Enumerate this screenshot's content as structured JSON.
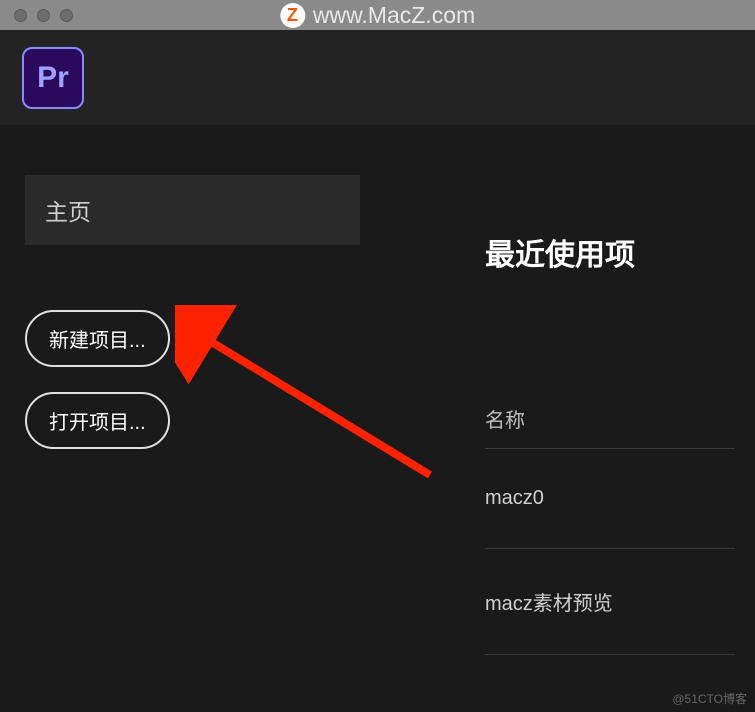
{
  "titlebar": {
    "watermark_text": "www.MacZ.com",
    "watermark_badge": "Z"
  },
  "toolbar": {
    "app_icon_label": "Pr"
  },
  "sidebar": {
    "home_label": "主页",
    "new_project_label": "新建项目...",
    "open_project_label": "打开项目..."
  },
  "main": {
    "recent_title": "最近使用项",
    "column_name": "名称",
    "projects": [
      {
        "name": "macz0"
      },
      {
        "name": "macz素材预览"
      }
    ]
  },
  "footer": {
    "watermark": "@51CTO博客"
  }
}
